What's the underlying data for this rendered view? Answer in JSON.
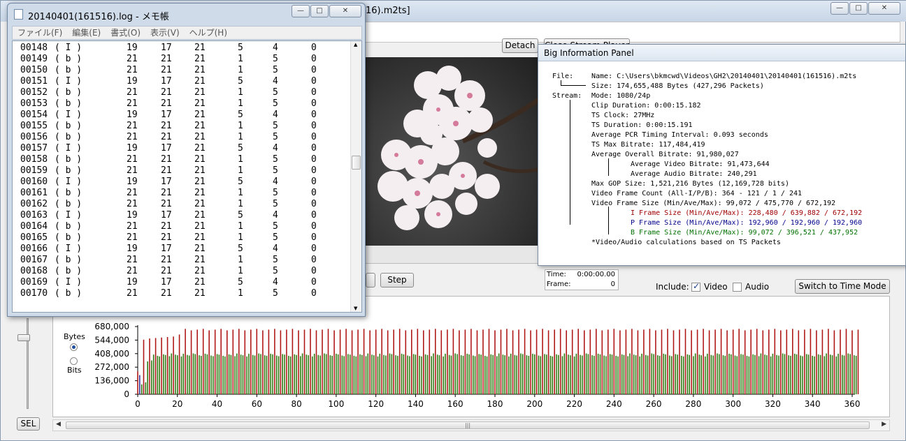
{
  "main_window": {
    "title": "16).m2ts]",
    "buttons": {
      "detach": "Detach",
      "close_stream_player": "Close Stream Player",
      "step": "Step",
      "switch_time_mode": "Switch to Time Mode",
      "sel": "SEL"
    },
    "time_label": "Time:",
    "time_value": "0:00:00.00",
    "frame_label": "Frame:",
    "frame_value": "0",
    "include_label": "Include:",
    "video_label": "Video",
    "video_checked": true,
    "audio_label": "Audio",
    "audio_checked": false,
    "units_bytes": "Bytes",
    "units_bits": "Bits",
    "units_selected": "Bytes"
  },
  "notepad": {
    "title": "20140401(161516).log - メモ帳",
    "menu": [
      "ファイル(F)",
      "編集(E)",
      "書式(O)",
      "表示(V)",
      "ヘルプ(H)"
    ],
    "rows": [
      [
        "00148",
        "( I )",
        "19",
        "17",
        "21",
        "5",
        "4",
        "0"
      ],
      [
        "00149",
        "( b )",
        "21",
        "21",
        "21",
        "1",
        "5",
        "0"
      ],
      [
        "00150",
        "( b )",
        "21",
        "21",
        "21",
        "1",
        "5",
        "0"
      ],
      [
        "00151",
        "( I )",
        "19",
        "17",
        "21",
        "5",
        "4",
        "0"
      ],
      [
        "00152",
        "( b )",
        "21",
        "21",
        "21",
        "1",
        "5",
        "0"
      ],
      [
        "00153",
        "( b )",
        "21",
        "21",
        "21",
        "1",
        "5",
        "0"
      ],
      [
        "00154",
        "( I )",
        "19",
        "17",
        "21",
        "5",
        "4",
        "0"
      ],
      [
        "00155",
        "( b )",
        "21",
        "21",
        "21",
        "1",
        "5",
        "0"
      ],
      [
        "00156",
        "( b )",
        "21",
        "21",
        "21",
        "1",
        "5",
        "0"
      ],
      [
        "00157",
        "( I )",
        "19",
        "17",
        "21",
        "5",
        "4",
        "0"
      ],
      [
        "00158",
        "( b )",
        "21",
        "21",
        "21",
        "1",
        "5",
        "0"
      ],
      [
        "00159",
        "( b )",
        "21",
        "21",
        "21",
        "1",
        "5",
        "0"
      ],
      [
        "00160",
        "( I )",
        "19",
        "17",
        "21",
        "5",
        "4",
        "0"
      ],
      [
        "00161",
        "( b )",
        "21",
        "21",
        "21",
        "1",
        "5",
        "0"
      ],
      [
        "00162",
        "( b )",
        "21",
        "21",
        "21",
        "1",
        "5",
        "0"
      ],
      [
        "00163",
        "( I )",
        "19",
        "17",
        "21",
        "5",
        "4",
        "0"
      ],
      [
        "00164",
        "( b )",
        "21",
        "21",
        "21",
        "1",
        "5",
        "0"
      ],
      [
        "00165",
        "( b )",
        "21",
        "21",
        "21",
        "1",
        "5",
        "0"
      ],
      [
        "00166",
        "( I )",
        "19",
        "17",
        "21",
        "5",
        "4",
        "0"
      ],
      [
        "00167",
        "( b )",
        "21",
        "21",
        "21",
        "1",
        "5",
        "0"
      ],
      [
        "00168",
        "( b )",
        "21",
        "21",
        "21",
        "1",
        "5",
        "0"
      ],
      [
        "00169",
        "( I )",
        "19",
        "17",
        "21",
        "5",
        "4",
        "0"
      ],
      [
        "00170",
        "( b )",
        "21",
        "21",
        "21",
        "1",
        "5",
        "0"
      ]
    ]
  },
  "info_panel": {
    "title": "Big Information Panel",
    "file_label": "File:",
    "name": "Name: C:\\Users\\bkmcwd\\Videos\\GH2\\20140401\\20140401(161516).m2ts",
    "size": "Size: 174,655,488 Bytes (427,296 Packets)",
    "stream_label": "Stream:",
    "mode": "Mode: 1080/24p",
    "clip_duration": "Clip Duration: 0:00:15.182",
    "ts_clock": "TS Clock: 27MHz",
    "ts_duration": "TS Duration:   0:00:15.191",
    "avg_pcr": "Average PCR Timing Interval: 0.093 seconds",
    "ts_max_bitrate": "TS Max Bitrate: 117,484,419",
    "avg_overall": "Average Overall Bitrate: 91,980,027",
    "avg_video": "Average Video Bitrate: 91,473,644",
    "avg_audio": "Average Audio Bitrate: 240,291",
    "max_gop": "Max GOP Size: 1,521,216 Bytes (12,169,728 bits)",
    "frame_count": "Video Frame Count (All-I/P/B): 364 - 121 / 1 / 241",
    "frame_size": "Video Frame Size (Min/Ave/Max): 99,072 / 475,770 / 672,192",
    "i_frame": "I Frame Size (Min/Ave/Max): 228,480 / 639,882 / 672,192",
    "p_frame": "P Frame Size (Min/Ave/Max): 192,960 / 192,960 / 192,960",
    "b_frame": "B Frame Size (Min/Ave/Max): 99,072 / 396,521 / 437,952",
    "footnote": "*Video/Audio calculations based on TS Packets"
  },
  "colors": {
    "i_frame": "#b01818",
    "p_frame": "#3535a0",
    "b_frame": "#2f7a12",
    "i_text": "#a00000",
    "p_text": "#00008b",
    "b_text": "#007000"
  },
  "chart_data": {
    "type": "bar",
    "ylabel": "Bytes",
    "ylim": [
      0,
      680000
    ],
    "xlim": [
      0,
      360
    ],
    "yticks": [
      "0",
      "136,000",
      "272,000",
      "408,000",
      "544,000",
      "680,000"
    ],
    "xticks": [
      "0",
      "20",
      "40",
      "60",
      "80",
      "100",
      "120",
      "140",
      "160",
      "180",
      "200",
      "220",
      "240",
      "260",
      "280",
      "300",
      "320",
      "340",
      "360"
    ],
    "gop_length": 3,
    "series": [
      {
        "name": "I",
        "values_note": "I-frames every 3rd frame",
        "typical": 650000,
        "first_values": [
          228480,
          548000,
          560000,
          565000,
          570000,
          575000,
          580000,
          600000
        ]
      },
      {
        "name": "P",
        "values": [
          192960
        ]
      },
      {
        "name": "B",
        "typical": 400000,
        "first_values": [
          99072,
          120000,
          330000,
          340000
        ]
      }
    ],
    "frame_count": 364
  }
}
